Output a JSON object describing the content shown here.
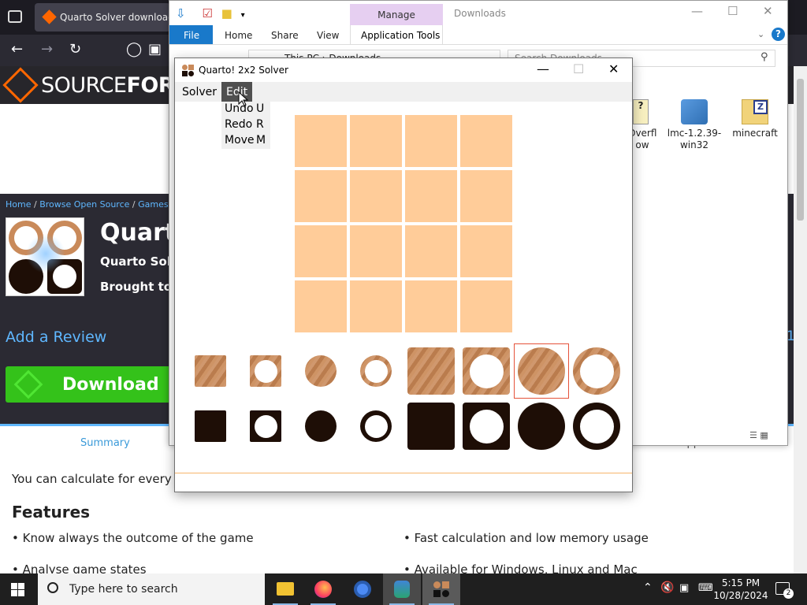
{
  "browser": {
    "tab_title": "Quarto Solver download |",
    "sf_word_light": "SOURCE",
    "sf_word_bold": "FORG",
    "breadcrumb": [
      "Home",
      "Browse Open Source",
      "Games",
      ""
    ],
    "project_title": "Quarto",
    "project_sub": "Quarto Solv",
    "project_by": "Brought to y",
    "add_review": "Add a Review",
    "download": "Download",
    "tab_summary": "Summary",
    "tab_support": "Support",
    "description": "You can calculate for every ga",
    "features_heading": "Features",
    "features": [
      "• Know always the outcome of the game",
      "• Fast calculation and low memory usage",
      "• Analyse game states",
      "• Available for Windows, Linux and Mac"
    ],
    "side_number": "1"
  },
  "explorer": {
    "manage": "Manage",
    "title": "Downloads",
    "ribbon_tabs": [
      "File",
      "Home",
      "Share",
      "View",
      "Application Tools"
    ],
    "help": "?",
    "address": "This PC  ›  Downloads",
    "search_placeholder": "Search Downloads",
    "files": [
      {
        "name": "Overfl\now",
        "icon": "stackoverflow-icon"
      },
      {
        "name": "lmc-1.2.39-\nwin32",
        "icon": "installer-icon"
      },
      {
        "name": "minecraft",
        "icon": "zip-folder-icon"
      }
    ]
  },
  "quarto": {
    "title": "Quarto! 2x2 Solver",
    "menus": [
      "Solver",
      "Edit"
    ],
    "edit_menu": [
      {
        "label": "Undo",
        "key": "U"
      },
      {
        "label": "Redo",
        "key": "R"
      },
      {
        "label": "Move",
        "key": "M"
      }
    ],
    "board_size": 4,
    "pieces": [
      {
        "color": "light",
        "shape": "square",
        "hole": false,
        "size": "small"
      },
      {
        "color": "light",
        "shape": "square",
        "hole": true,
        "size": "small"
      },
      {
        "color": "light",
        "shape": "circle",
        "hole": false,
        "size": "small"
      },
      {
        "color": "light",
        "shape": "circle",
        "hole": true,
        "size": "small"
      },
      {
        "color": "light",
        "shape": "square",
        "hole": false,
        "size": "large"
      },
      {
        "color": "light",
        "shape": "square",
        "hole": true,
        "size": "large"
      },
      {
        "color": "light",
        "shape": "circle",
        "hole": false,
        "size": "large",
        "selected": true
      },
      {
        "color": "light",
        "shape": "circle",
        "hole": true,
        "size": "large"
      },
      {
        "color": "dark",
        "shape": "square",
        "hole": false,
        "size": "small"
      },
      {
        "color": "dark",
        "shape": "square",
        "hole": true,
        "size": "small"
      },
      {
        "color": "dark",
        "shape": "circle",
        "hole": false,
        "size": "small"
      },
      {
        "color": "dark",
        "shape": "circle",
        "hole": true,
        "size": "small"
      },
      {
        "color": "dark",
        "shape": "square",
        "hole": false,
        "size": "large"
      },
      {
        "color": "dark",
        "shape": "square",
        "hole": true,
        "size": "large"
      },
      {
        "color": "dark",
        "shape": "circle",
        "hole": false,
        "size": "large"
      },
      {
        "color": "dark",
        "shape": "circle",
        "hole": true,
        "size": "large"
      }
    ],
    "colors": {
      "board_cell": "#ffcc99",
      "selection": "#e5523a",
      "light_wood": "#c98a5a",
      "dark_wood": "#1e0e06"
    }
  },
  "taskbar": {
    "search_placeholder": "Type here to search",
    "time": "5:15 PM",
    "date": "10/28/2024",
    "notifications": "2"
  }
}
